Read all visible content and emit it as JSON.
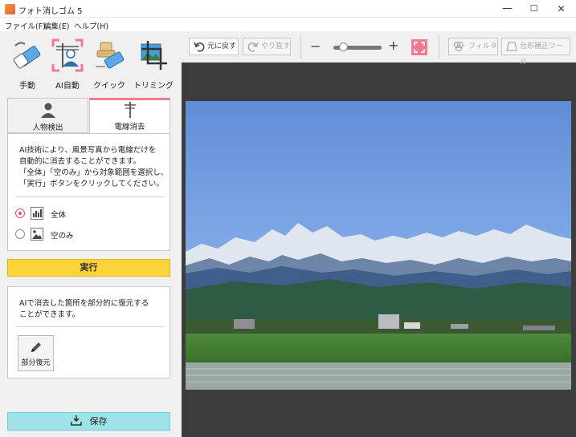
{
  "window": {
    "title": "フォト消しゴム 5",
    "controls": {
      "minimize": "—",
      "maximize": "☐",
      "close": "✕"
    }
  },
  "menu": {
    "items": [
      "ファイル(F)",
      "編集(E)",
      "ヘルプ(H)"
    ]
  },
  "tools": [
    {
      "label": "手動",
      "icon": "eraser-icon"
    },
    {
      "label": "AI自動",
      "icon": "ai-person-icon",
      "selected": true
    },
    {
      "label": "クイック",
      "icon": "stamp-eraser-icon"
    },
    {
      "label": "トリミング",
      "icon": "crop-icon"
    }
  ],
  "tabs": [
    {
      "label": "人物検出",
      "icon": "person-icon"
    },
    {
      "label": "電線消去",
      "icon": "power-pole-icon",
      "active": true
    }
  ],
  "description": [
    "AI技術により、風景写真から電線だけを",
    "自動的に消去することができます。",
    "「全体」「空のみ」から対象範囲を選択し、",
    "「実行」ボタンをクリックしてください。"
  ],
  "scope_options": [
    {
      "label": "全体",
      "icon": "chart-icon",
      "selected": true
    },
    {
      "label": "空のみ",
      "icon": "landscape-icon",
      "selected": false
    }
  ],
  "run_label": "実行",
  "restore": {
    "description": [
      "AIで消去した箇所を部分的に復元する",
      "ことができます。"
    ],
    "button_label": "部分復元"
  },
  "save_label": "保存",
  "toolbar": {
    "undo_label": "元に戻す",
    "redo_label": "やり直す",
    "zoom_out": "−",
    "zoom_in": "+",
    "zoom_level": 0.2,
    "filter_label": "フィルタ",
    "keystone_label": "台形補正ツール"
  },
  "colors": {
    "accent_pink": "#f07a94",
    "run_yellow": "#fdd33a",
    "save_cyan": "#9fe3ea",
    "canvas_bg": "#3c3c3c"
  }
}
